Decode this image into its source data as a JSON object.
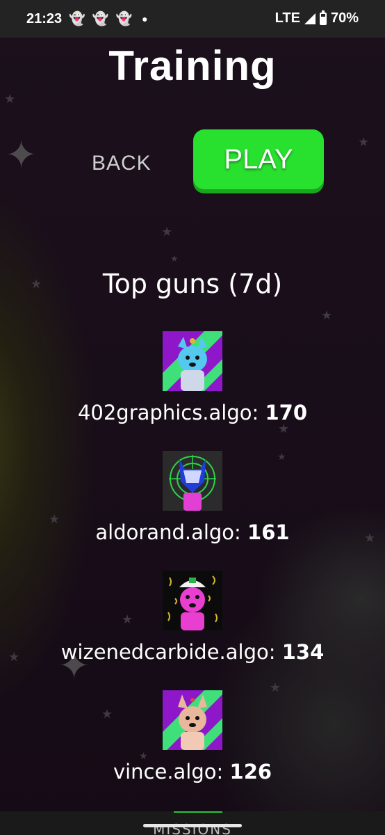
{
  "status_bar": {
    "time": "21:23",
    "network": "LTE",
    "battery": "70%",
    "notification_icons": [
      "snapchat-icon",
      "snapchat-icon",
      "snapchat-icon"
    ]
  },
  "page": {
    "title": "Training",
    "back_label": "BACK",
    "play_label": "PLAY",
    "play_color": "#28e02e"
  },
  "leaderboard": {
    "heading": "Top guns (7d)",
    "entries": [
      {
        "name": "402graphics.algo:",
        "score": "170",
        "avatar": "cyan-dog-avatar"
      },
      {
        "name": "aldorand.algo:",
        "score": "161",
        "avatar": "neon-helmet-avatar"
      },
      {
        "name": "wizenedcarbide.algo:",
        "score": "134",
        "avatar": "pink-dog-avatar"
      },
      {
        "name": "vince.algo:",
        "score": "126",
        "avatar": "tan-dog-avatar"
      }
    ]
  },
  "footer": {
    "partial_text": "MISSIONS"
  }
}
